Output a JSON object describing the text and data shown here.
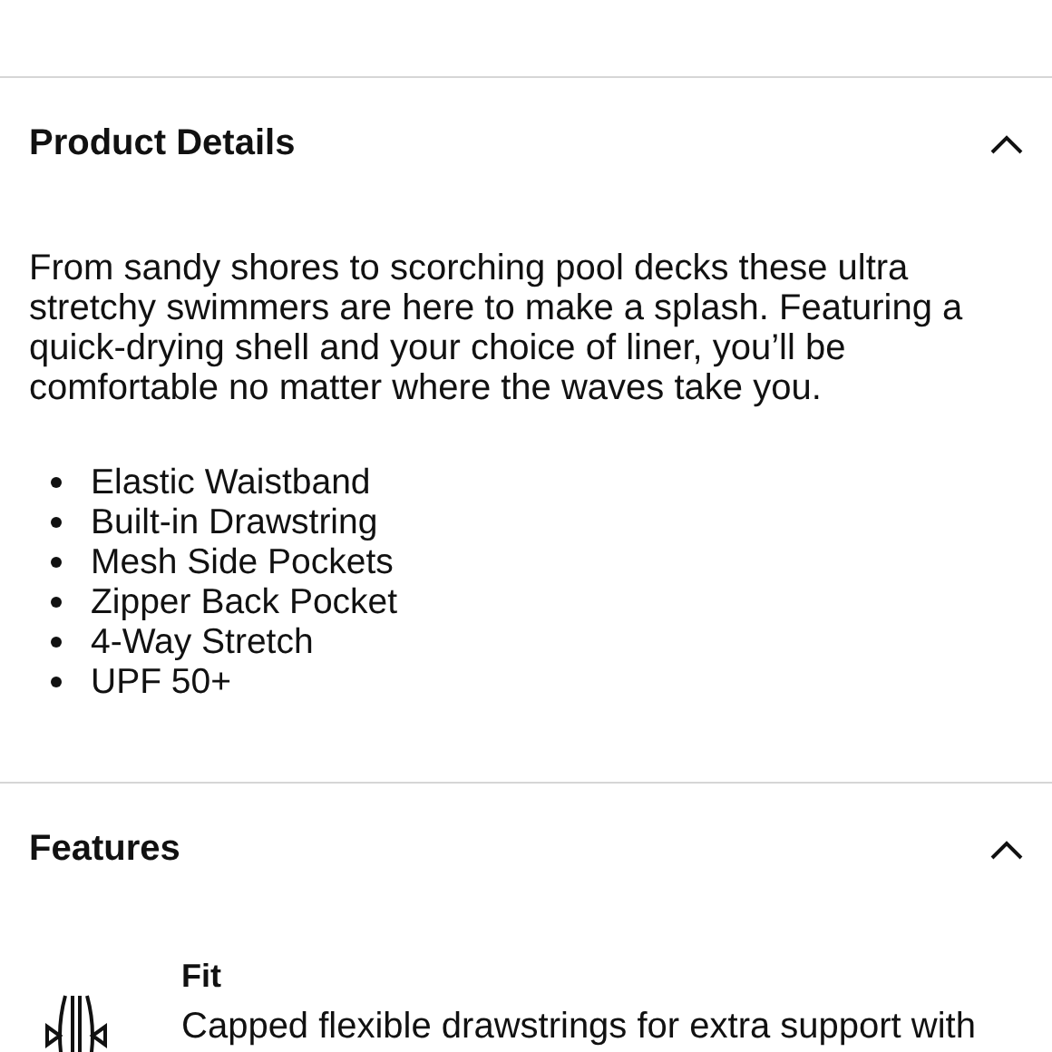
{
  "sections": [
    {
      "title": "Product Details",
      "expanded": true,
      "kind": "details",
      "description": "From sandy shores to scorching pool decks these ultra stretchy swimmers are here to make a splash. Featuring a quick-drying shell and your choice of liner, you’ll be comfortable no matter where the waves take you.",
      "bullets": [
        "Elastic Waistband",
        "Built-in Drawstring",
        "Mesh Side Pockets",
        "Zipper Back Pocket",
        "4-Way Stretch",
        "UPF 50+"
      ]
    },
    {
      "title": "Features",
      "expanded": true,
      "kind": "features",
      "features": [
        {
          "title": "Fit",
          "text": "Capped flexible drawstrings for extra support with"
        }
      ]
    }
  ]
}
